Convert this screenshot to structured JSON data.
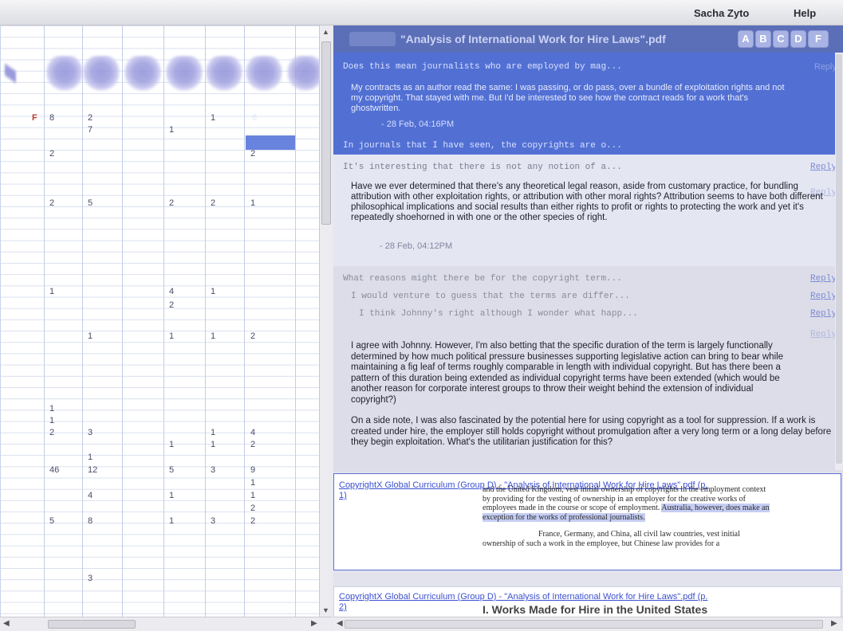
{
  "topbar": {
    "user_name": "Sacha Zyto",
    "help_label": "Help"
  },
  "left_grid": {
    "marker": "F",
    "rows": [
      [
        "8",
        "2",
        "",
        "1",
        "",
        "6"
      ],
      [
        "",
        "7",
        "1",
        "",
        "",
        ""
      ],
      [
        "2",
        "",
        "",
        "",
        "2",
        ""
      ],
      [
        "2",
        "5",
        "2",
        "2",
        "1",
        ""
      ],
      [
        "1",
        "",
        "4",
        "1",
        "",
        ""
      ],
      [
        "",
        "",
        "2",
        "",
        "",
        ""
      ],
      [
        "",
        "1",
        "1",
        "1",
        "2",
        ""
      ],
      [
        "1",
        "",
        "",
        "",
        "",
        ""
      ],
      [
        "1",
        "",
        "",
        "",
        "",
        ""
      ],
      [
        "2",
        "3",
        "",
        "1",
        "4",
        ""
      ],
      [
        "",
        "",
        "1",
        "1",
        "2",
        ""
      ],
      [
        "",
        "1",
        "",
        "",
        "",
        ""
      ],
      [
        "46",
        "12",
        "5",
        "3",
        "9",
        ""
      ],
      [
        "",
        "",
        "",
        "",
        "1",
        ""
      ],
      [
        "",
        "4",
        "1",
        "",
        "1",
        ""
      ],
      [
        "",
        "",
        "",
        "",
        "2",
        ""
      ],
      [
        "5",
        "8",
        "1",
        "3",
        "2",
        ""
      ],
      [
        "",
        "3",
        "",
        "",
        "",
        ""
      ]
    ]
  },
  "document": {
    "title": "\"Analysis of International Work for Hire Laws\".pdf",
    "filters": [
      "A",
      "B",
      "C",
      "D",
      "F"
    ]
  },
  "threads": {
    "t1": {
      "head": "Does this mean journalists who are employed by mag...",
      "body": "My contracts as an author read the same: I was passing, or do pass, over a bundle of exploitation rights and not my copyright. That stayed with me. But I'd be interested to see how the contract reads for a work that's ghostwritten.",
      "meta": "- 28 Feb, 04:16PM",
      "reply": "Reply",
      "foot": "In journals that I have seen, the copyrights are o..."
    },
    "t2": {
      "head": "It's interesting that there is not any notion of a...",
      "reply": "Reply",
      "body": "Have we ever determined that there's any theoretical legal reason, aside from customary practice, for bundling attribution with other exploitation rights, or attribution with other moral rights? Attribution seems to have both different philosophical implications and social results than either rights to profit or rights to protecting the work and yet it's repeatedly shoehorned in with one or the other species of right.",
      "meta": "- 28 Feb, 04:12PM",
      "reply2": "Reply"
    },
    "t3": {
      "line1": "What reasons might there be for the copyright term...",
      "line2": "I would venture to guess that the terms are differ...",
      "line3": "I think Johnny's right although I wonder what happ...",
      "reply": "Reply",
      "body1": "I agree with Johnny. However, I'm also betting that the specific duration of the term is largely functionally determined by how much political pressure businesses supporting legislative action can bring to bear while maintaining a fig leaf of terms roughly comparable in length with individual copyright. But has there been a pattern of this duration being extended as individual copyright terms have been extended (which would be another reason for corporate interest groups to throw their weight behind the extension of individual copyright?)",
      "body2": "On a side note, I was also fascinated by the potential here for using copyright as a tool for suppression. If a work is created under hire, the employer still holds copyright without promulgation after a very long term or a long delay before they begin exploitation. What's the utilitarian justification for this?"
    }
  },
  "citations": [
    {
      "link": "CopyrightX Global Curriculum (Group D) - \"Analysis of International Work for Hire Laws\".pdf (p.",
      "page": "1)",
      "excerpt_top": "and the United Kingdom, vest initial ownership of copyrights in the employment context by providing for the vesting of ownership in an employer for the creative works of employees made in the course or scope of employment.",
      "excerpt_hl": "Australia, however, does make an exception for the works of professional journalists.",
      "excerpt_bottom": "France, Germany, and China, all civil law countries, vest initial ownership of such a work in the employee, but Chinese law provides for a"
    },
    {
      "link": "CopyrightX Global Curriculum (Group D) - \"Analysis of International Work for Hire Laws\".pdf (p.",
      "page": "2)",
      "section": "I. Works Made for Hire in the United States"
    }
  ],
  "scroll": {
    "grip": "III"
  },
  "colors": {
    "accent": "#5270d3",
    "header": "#5b6fb8",
    "link": "#3b4fd1",
    "marker": "#c0392b"
  }
}
